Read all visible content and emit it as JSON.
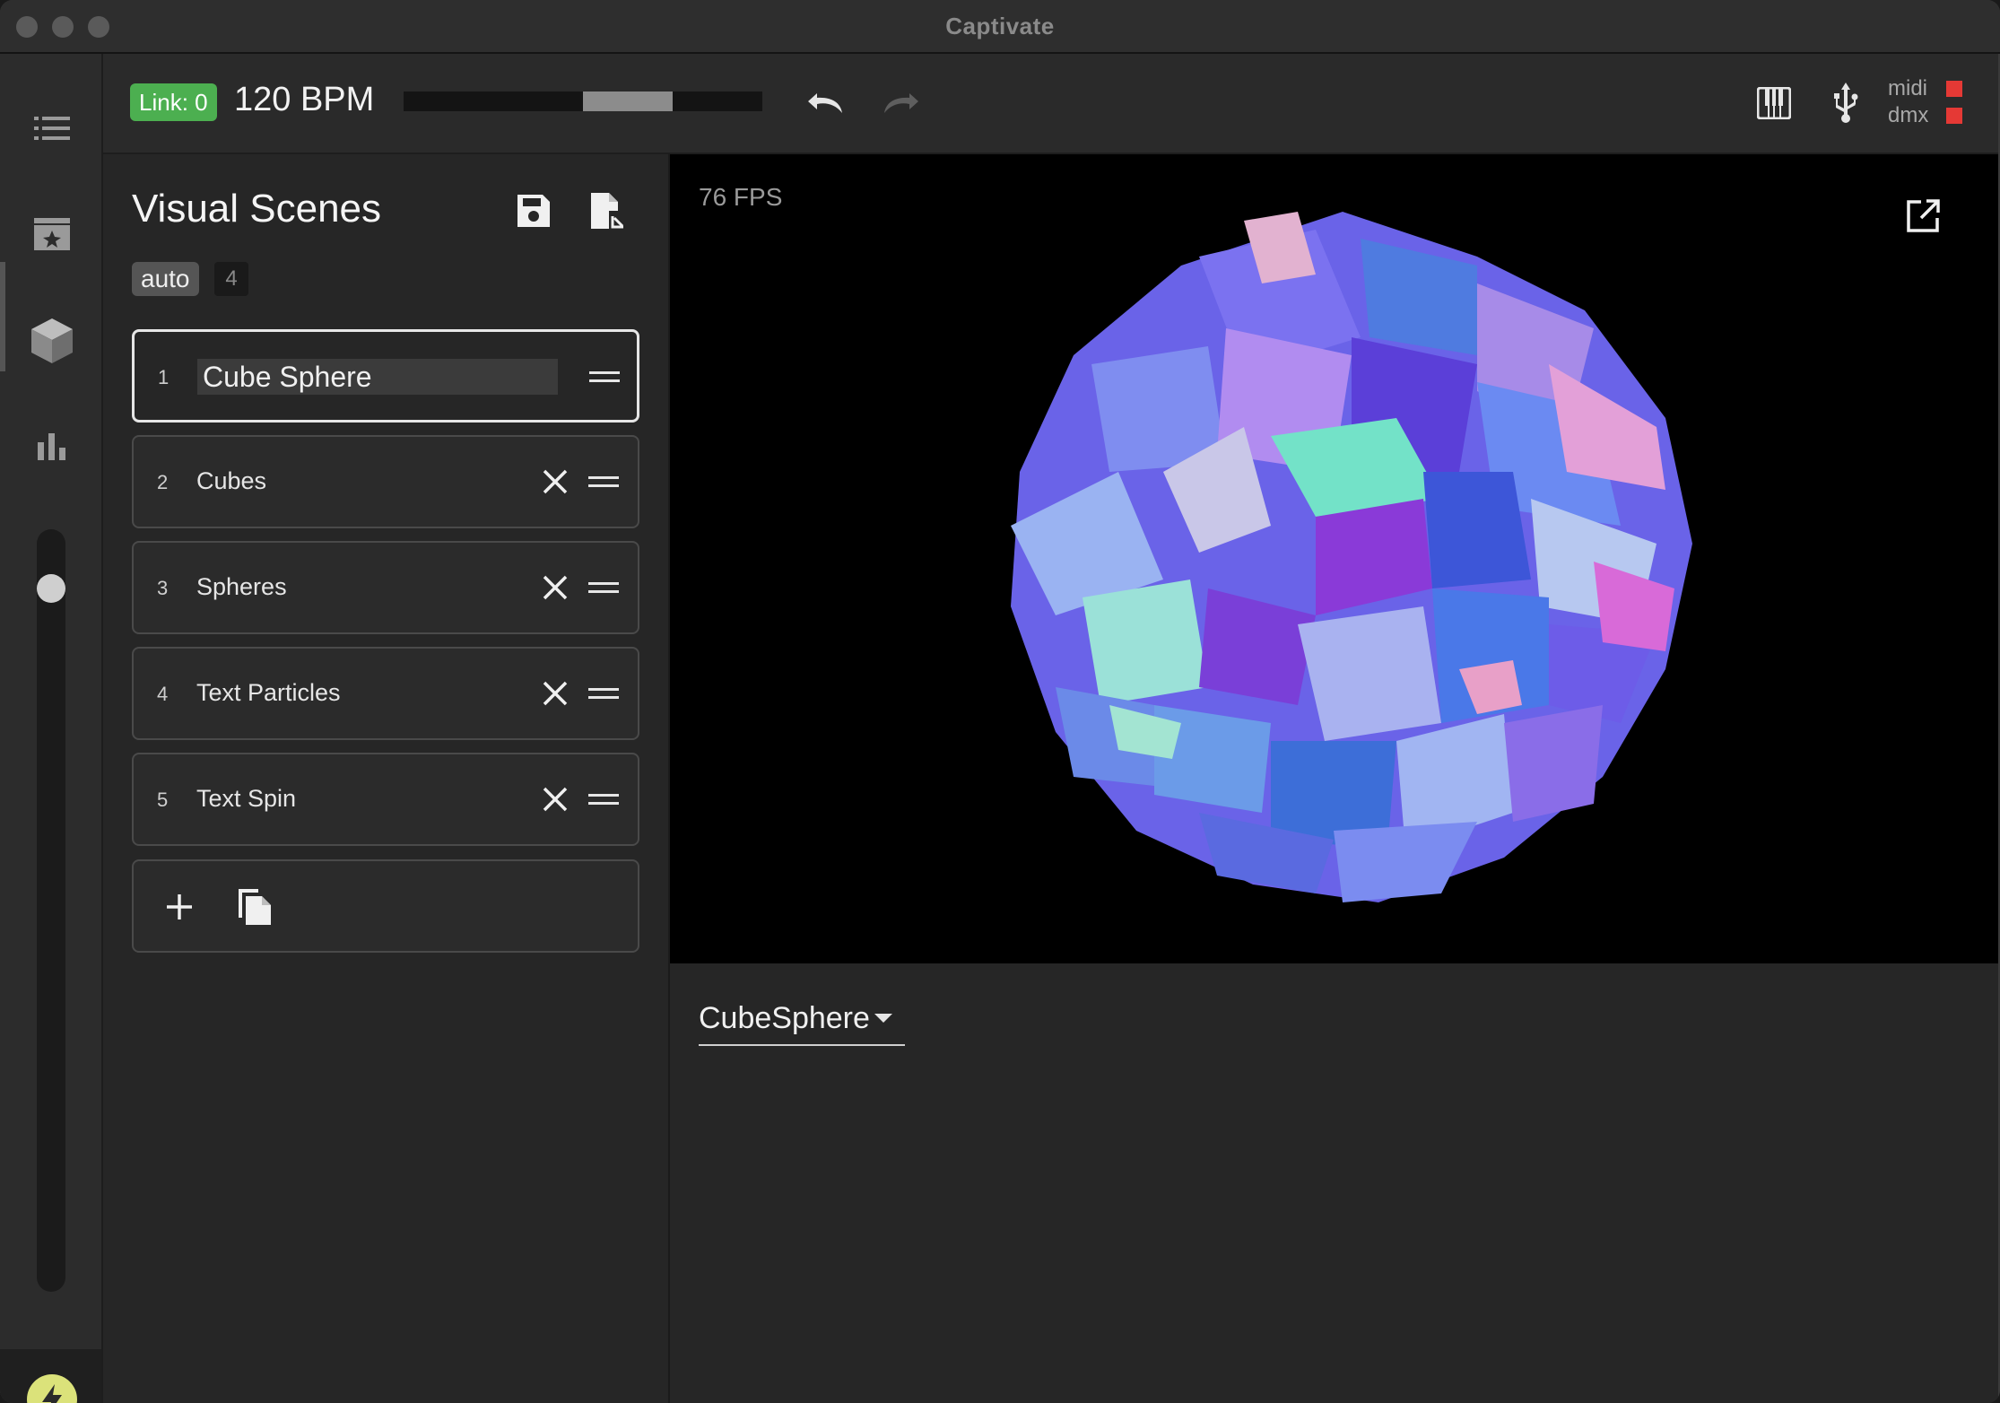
{
  "window": {
    "title": "Captivate"
  },
  "nav": {
    "items": [
      {
        "icon": "list-icon"
      },
      {
        "icon": "video-scenes-icon"
      },
      {
        "icon": "cube-icon"
      },
      {
        "icon": "bar-chart-icon"
      }
    ],
    "master_fader_level": 0.92,
    "bottom_icon": "bolt-icon"
  },
  "toolbar": {
    "link_label": "Link: 0",
    "bpm_label": "120 BPM",
    "undo_icon": "undo-icon",
    "redo_icon": "redo-icon",
    "piano_icon": "piano-icon",
    "usb_icon": "usb-icon",
    "status": [
      {
        "label": "midi",
        "color": "#e53935"
      },
      {
        "label": "dmx",
        "color": "#e53935"
      }
    ]
  },
  "scenes": {
    "title": "Visual Scenes",
    "auto_label": "auto",
    "auto_count": "4",
    "items": [
      {
        "num": "1",
        "name": "Cube Sphere",
        "active": true
      },
      {
        "num": "2",
        "name": "Cubes"
      },
      {
        "num": "3",
        "name": "Spheres"
      },
      {
        "num": "4",
        "name": "Text Particles"
      },
      {
        "num": "5",
        "name": "Text Spin"
      }
    ]
  },
  "preview": {
    "fps": "76 FPS"
  },
  "settings": {
    "visualizer_select": "CubeSphere"
  },
  "colors": {
    "link_green": "#4caf50",
    "status_red": "#e53935",
    "fader_knob": "#cfcfcf"
  }
}
